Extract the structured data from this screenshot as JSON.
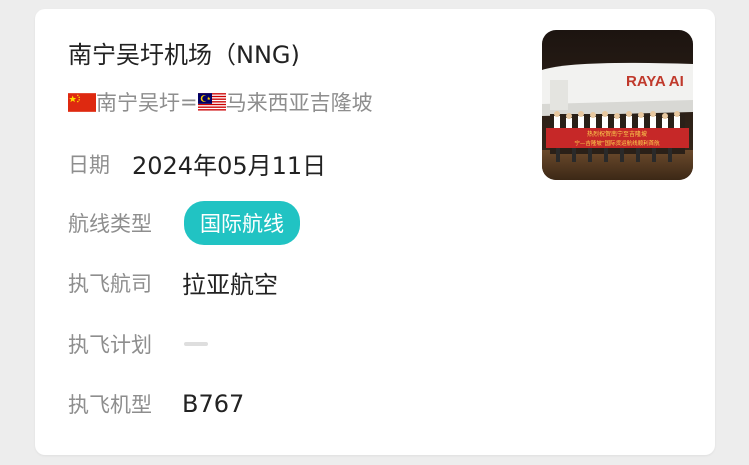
{
  "card": {
    "title": "南宁吴圩机场（NNG)",
    "route": {
      "origin": "南宁吴圩",
      "separator": "=",
      "destination": "马来西亚吉隆坡",
      "origin_flag_icon": "china-flag-icon",
      "destination_flag_icon": "malaysia-flag-icon"
    },
    "date": {
      "label": "日期",
      "value": "2024年05月11日"
    },
    "route_type": {
      "label": "航线类型",
      "value": "国际航线"
    },
    "airline": {
      "label": "执飞航司",
      "value": "拉亚航空"
    },
    "schedule": {
      "label": "执飞计划",
      "value": ""
    },
    "aircraft": {
      "label": "执飞机型",
      "value": "B767"
    },
    "photo": {
      "plane_text": "RAYA AI",
      "banner_line1": "热烈祝贺南宁至吉隆坡",
      "banner_line2": "宁—吉隆坡”国际货运航线顺利首航"
    }
  },
  "colors": {
    "accent": "#21c3c3",
    "label_gray": "#8e8e8e",
    "text_dark": "#222222",
    "placeholder_dash": "#dedede"
  }
}
